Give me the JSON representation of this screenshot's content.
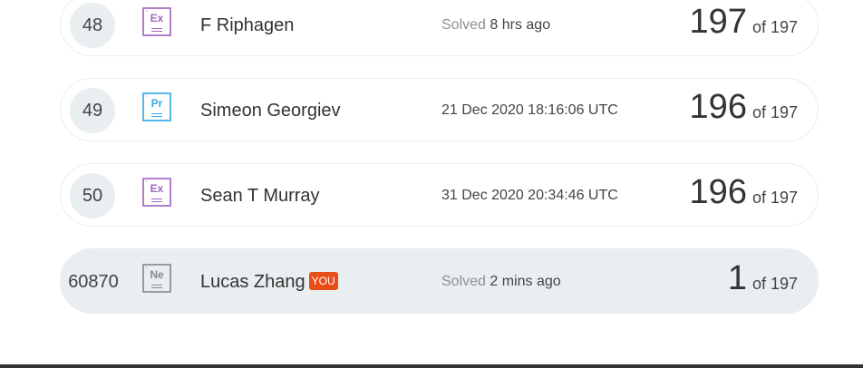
{
  "rows": [
    {
      "rank": "48",
      "level": "Ex",
      "name": "F Riphagen",
      "time_prefix": "Solved",
      "time": "8 hrs ago",
      "score": "197",
      "total": "of 197"
    },
    {
      "rank": "49",
      "level": "Pr",
      "name": "Simeon Georgiev",
      "time_prefix": "",
      "time": "21 Dec 2020 18:16:06 UTC",
      "score": "196",
      "total": "of 197"
    },
    {
      "rank": "50",
      "level": "Ex",
      "name": "Sean T Murray",
      "time_prefix": "",
      "time": "31 Dec 2020 20:34:46 UTC",
      "score": "196",
      "total": "of 197"
    }
  ],
  "me": {
    "rank": "60870",
    "level": "Ne",
    "name": "Lucas Zhang",
    "badge": "YOU",
    "time_prefix": "Solved",
    "time": "2 mins ago",
    "score": "1",
    "total": "of 197"
  },
  "colors": {
    "accent_badge": "#ea4e18",
    "level_ex": "#a267bd",
    "level_pr": "#39a9df",
    "level_ne": "#8a8a8a",
    "my_row_bg": "#e9eef0"
  }
}
